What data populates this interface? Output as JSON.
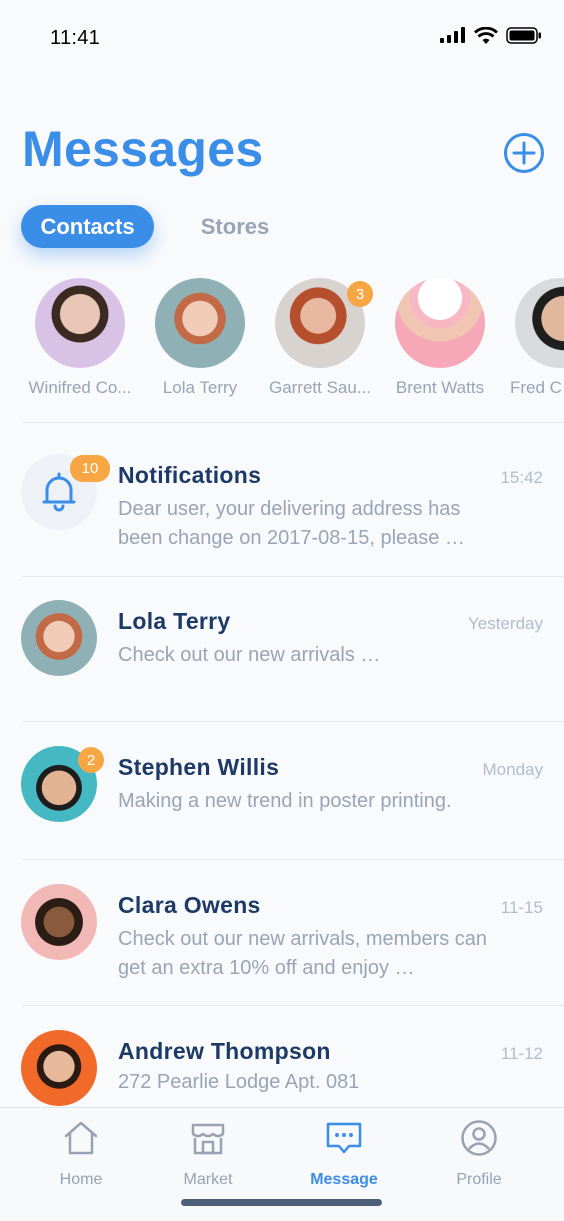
{
  "status": {
    "time": "11:41"
  },
  "header": {
    "title": "Messages"
  },
  "tabs": {
    "contacts": "Contacts",
    "stores": "Stores"
  },
  "contacts": [
    {
      "name": "Winifred Co...",
      "badge": null
    },
    {
      "name": "Lola Terry",
      "badge": null
    },
    {
      "name": "Garrett Sau...",
      "badge": "3"
    },
    {
      "name": "Brent Watts",
      "badge": null
    },
    {
      "name": "Fred C",
      "badge": null
    }
  ],
  "messages": [
    {
      "name": "Notifications",
      "time": "15:42",
      "text": "Dear user, your delivering address has been change on 2017-08-15, please …",
      "badge": "10"
    },
    {
      "name": "Lola Terry",
      "time": "Yesterday",
      "text": "Check out our new arrivals …",
      "badge": null
    },
    {
      "name": "Stephen Willis",
      "time": "Monday",
      "text": "Making a new trend in poster printing.",
      "badge": "2"
    },
    {
      "name": "Clara Owens",
      "time": "11-15",
      "text": "Check out our new arrivals, members can get an extra 10% off and enjoy …",
      "badge": null
    },
    {
      "name": "Andrew Thompson",
      "time": "11-12",
      "text": "272 Pearlie Lodge Apt. 081",
      "badge": null
    }
  ],
  "nav": {
    "home": "Home",
    "market": "Market",
    "message": "Message",
    "profile": "Profile"
  },
  "colors": {
    "accent": "#3b8ee8",
    "badge": "#f7a644",
    "title_text": "#1d3a66",
    "muted": "#9aa4b6"
  }
}
